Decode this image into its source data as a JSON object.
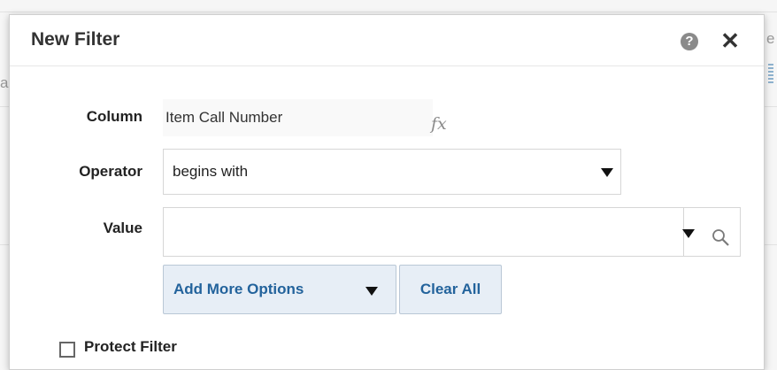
{
  "dialog": {
    "title": "New Filter",
    "help_icon": "help-icon",
    "close_icon": "close-icon",
    "help_glyph": "?",
    "close_glyph": "✕"
  },
  "form": {
    "column_label": "Column",
    "column_value": "Item Call Number",
    "fx_label": "fx",
    "operator_label": "Operator",
    "operator_value": "begins with",
    "value_label": "Value",
    "value_value": ""
  },
  "buttons": {
    "add_more_options": "Add More Options",
    "clear_all": "Clear All"
  },
  "checkbox": {
    "protect_filter_label": "Protect Filter",
    "checked": false
  },
  "background": {
    "fragment_left": "all",
    "fragment_right": "e"
  },
  "colors": {
    "link_blue": "#23639c",
    "button_bg": "#e7eef6",
    "border": "#d6d6d6"
  }
}
